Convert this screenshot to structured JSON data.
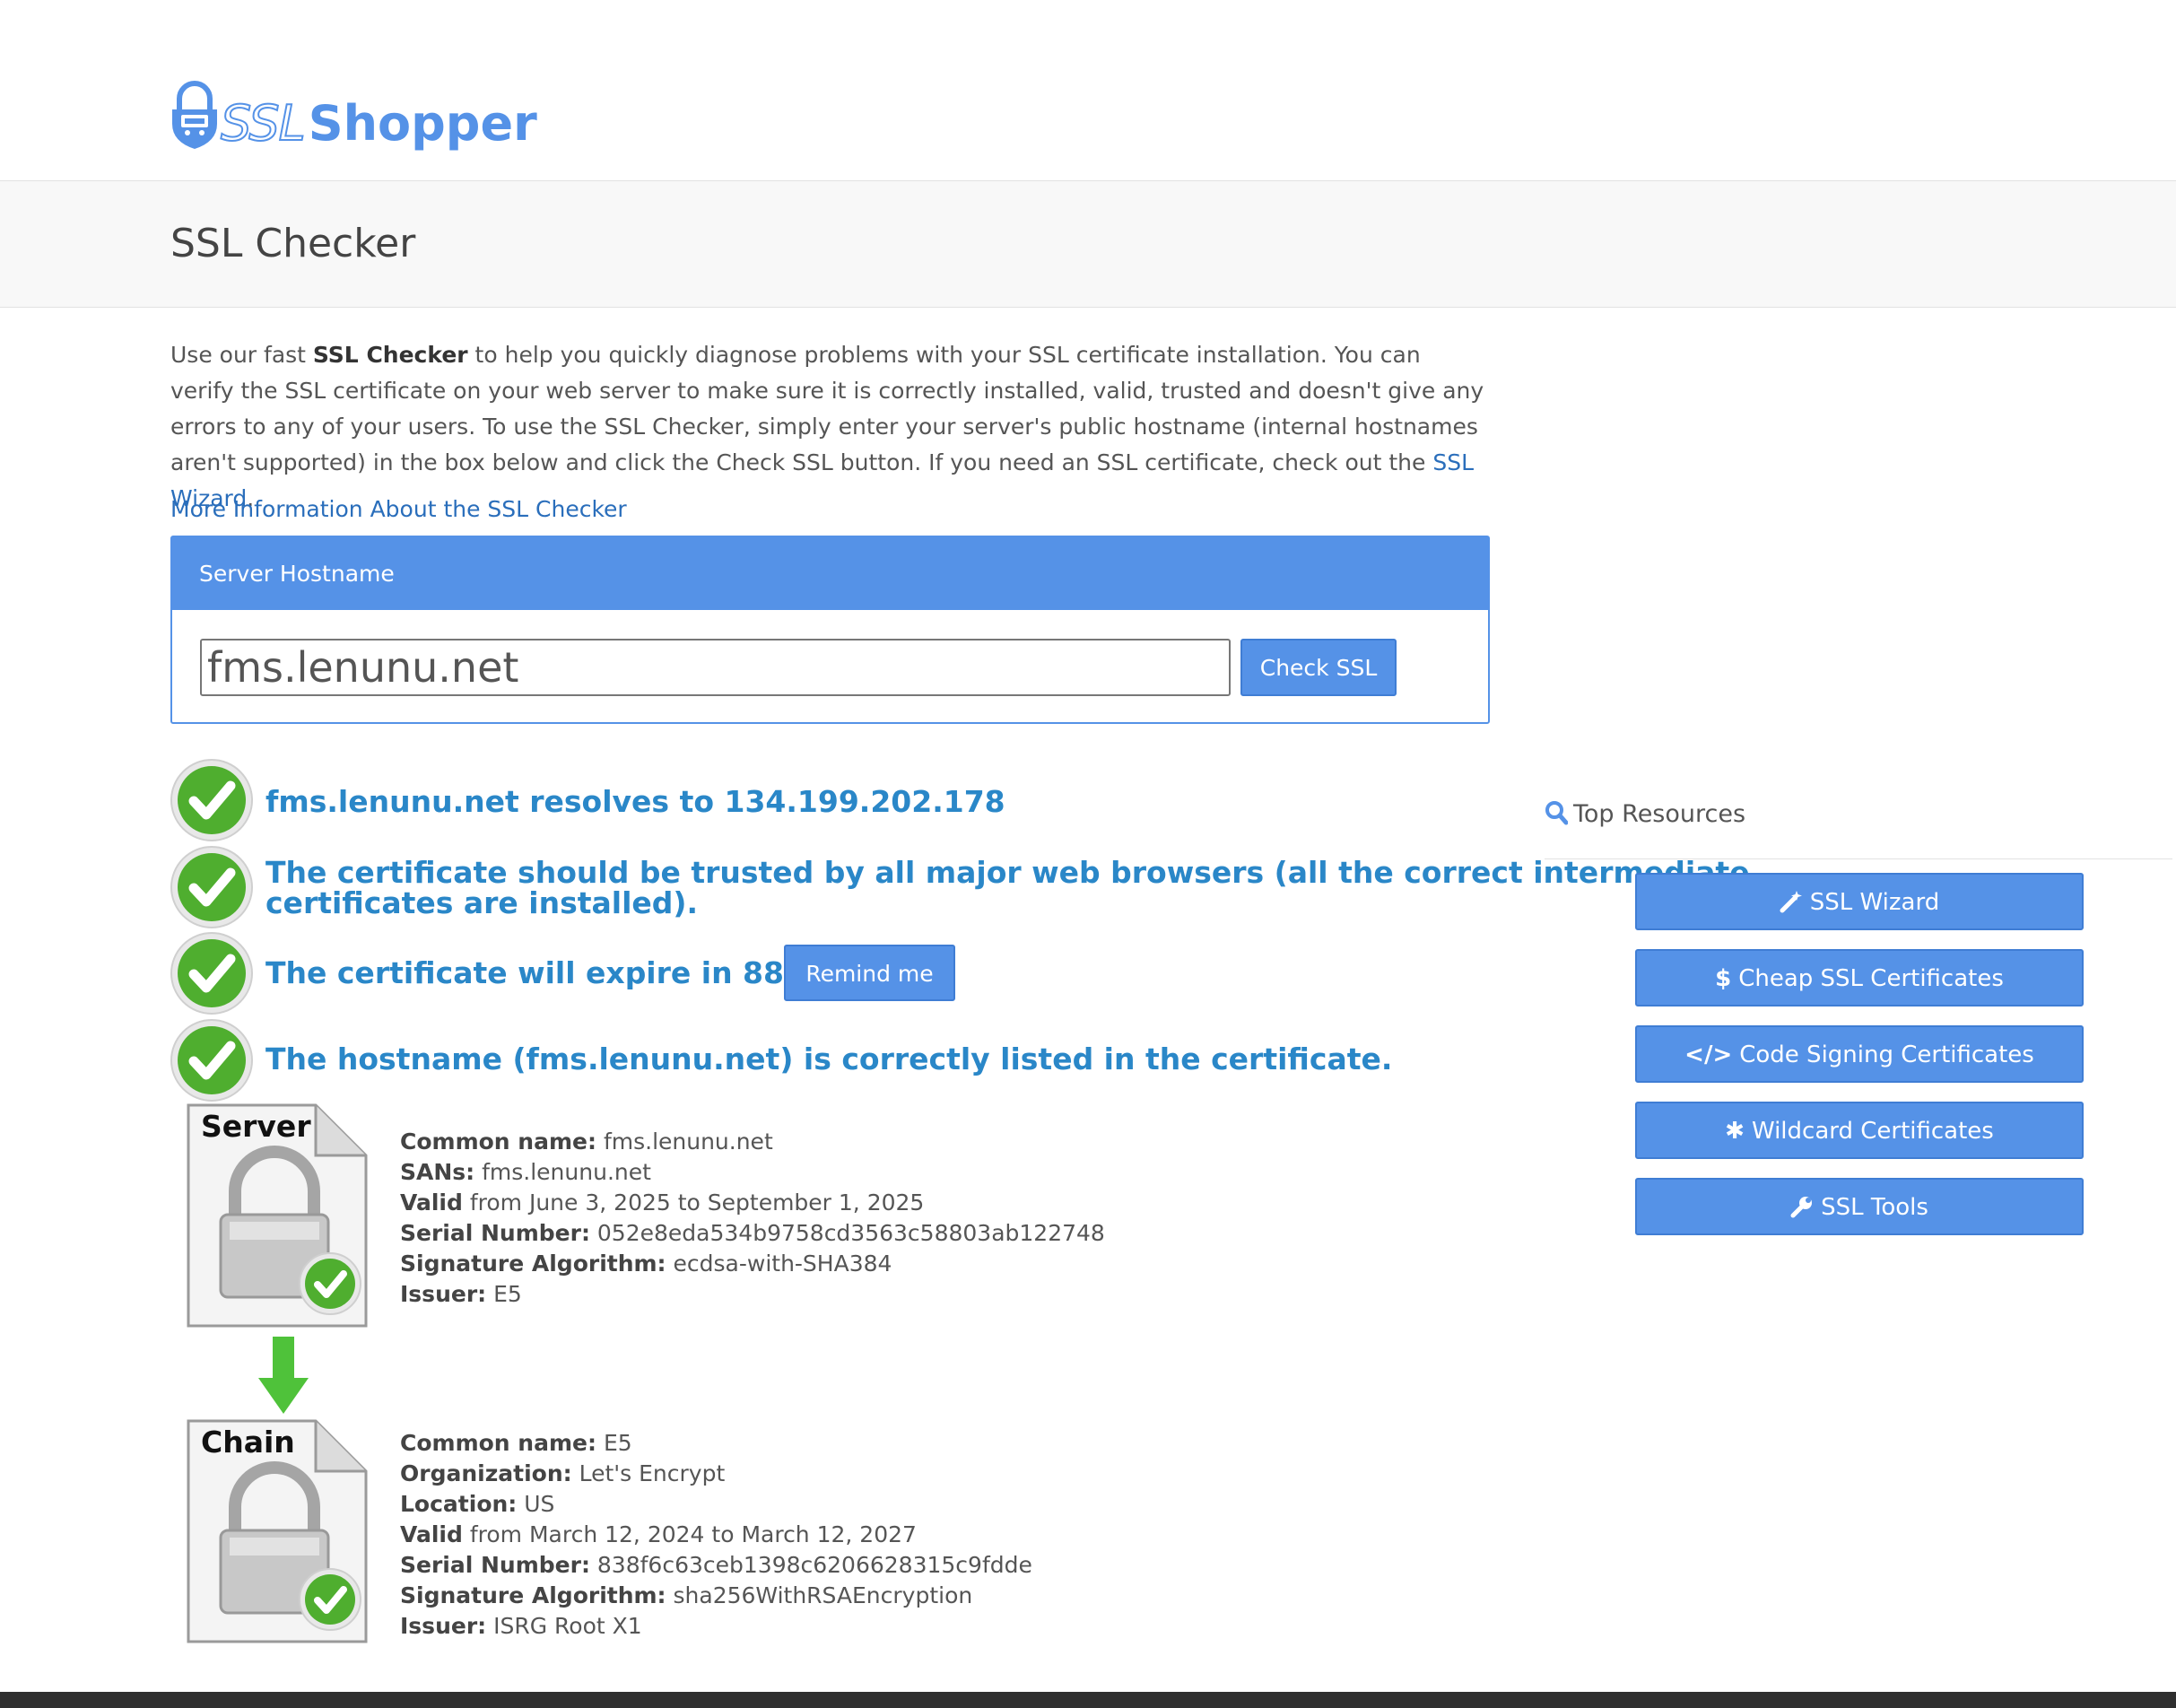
{
  "brand": {
    "name_part1": "SSL",
    "name_part2": "Shopper",
    "accent": "#5592e7",
    "link_color": "#2a6ebb",
    "result_color": "#2a87c8"
  },
  "page": {
    "title": "SSL Checker"
  },
  "intro": {
    "text_1": "Use our fast ",
    "bold": "SSL Checker",
    "text_2": " to help you quickly diagnose problems with your SSL certificate installation. You can verify the SSL certificate on your web server to make sure it is correctly installed, valid, trusted and doesn't give any errors to any of your users. To use the SSL Checker, simply enter your server's public hostname (internal hostnames aren't supported) in the box below and click the Check SSL button. If you need an SSL certificate, check out the ",
    "wizard_link": "SSL Wizard",
    "text_3": ".",
    "more_info_link": "More Information About the SSL Checker"
  },
  "form": {
    "panel_title": "Server Hostname",
    "hostname_value": "fms.lenunu.net",
    "check_button": "Check SSL"
  },
  "results": {
    "resolves": "fms.lenunu.net resolves to 134.199.202.178",
    "trusted_line1": "The certificate should be trusted by all major web browsers (all the correct intermediate",
    "trusted_line2": "certificates are installed).",
    "expire": "The certificate will expire in 88 days.",
    "remind_button": "Remind me",
    "hostname_listed": "The hostname (fms.lenunu.net) is correctly listed in the certificate."
  },
  "server_cert": {
    "icon_label": "Server",
    "common_name_label": "Common name:",
    "common_name": "fms.lenunu.net",
    "sans_label": "SANs:",
    "sans": "fms.lenunu.net",
    "valid_label": "Valid",
    "valid": "from June 3, 2025 to September 1, 2025",
    "serial_label": "Serial Number:",
    "serial": "052e8eda534b9758cd3563c58803ab122748",
    "sigalg_label": "Signature Algorithm:",
    "sigalg": "ecdsa-with-SHA384",
    "issuer_label": "Issuer:",
    "issuer": "E5"
  },
  "chain_cert": {
    "icon_label": "Chain",
    "common_name_label": "Common name:",
    "common_name": "E5",
    "org_label": "Organization:",
    "org": "Let's Encrypt",
    "location_label": "Location:",
    "location": "US",
    "valid_label": "Valid",
    "valid": "from March 12, 2024 to March 12, 2027",
    "serial_label": "Serial Number:",
    "serial": "838f6c63ceb1398c6206628315c9fdde",
    "sigalg_label": "Signature Algorithm:",
    "sigalg": "sha256WithRSAEncryption",
    "issuer_label": "Issuer:",
    "issuer": "ISRG Root X1"
  },
  "sidebar": {
    "heading": "Top Resources",
    "buttons": [
      {
        "label": "SSL Wizard",
        "icon": "magic-wand-icon"
      },
      {
        "label": "Cheap SSL Certificates",
        "icon": "dollar-icon"
      },
      {
        "label": "Code Signing Certificates",
        "icon": "code-icon"
      },
      {
        "label": "Wildcard Certificates",
        "icon": "asterisk-icon"
      },
      {
        "label": "SSL Tools",
        "icon": "wrench-icon"
      }
    ]
  }
}
